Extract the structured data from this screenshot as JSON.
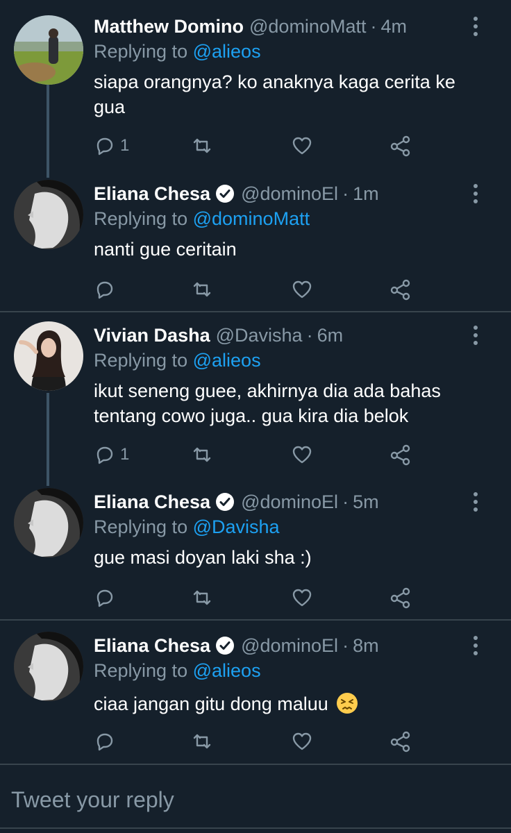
{
  "tweets": [
    {
      "name": "Matthew Domino",
      "handle": "@dominoMatt",
      "separator": "·",
      "time": "4m",
      "replying_prefix": "Replying to",
      "replying_to": "@alieos",
      "text": "siapa orangnya? ko anaknya kaga cerita ke gua",
      "reply_count": "1",
      "verified": false,
      "avatar": "landscape-photo-avatar"
    },
    {
      "name": "Eliana Chesa",
      "handle": "@dominoEl",
      "separator": "·",
      "time": "1m",
      "replying_prefix": "Replying to",
      "replying_to": "@dominoMatt",
      "text": "nanti gue ceritain",
      "reply_count": "",
      "verified": true,
      "avatar": "bw-profile-avatar"
    },
    {
      "name": "Vivian Dasha",
      "handle": "@Davisha",
      "separator": "·",
      "time": "6m",
      "replying_prefix": "Replying to",
      "replying_to": "@alieos",
      "text": "ikut seneng guee, akhirnya dia ada bahas tentang cowo juga.. gua kira dia belok",
      "reply_count": "1",
      "verified": false,
      "avatar": "girl-portrait-avatar"
    },
    {
      "name": "Eliana Chesa",
      "handle": "@dominoEl",
      "separator": "·",
      "time": "5m",
      "replying_prefix": "Replying to",
      "replying_to": "@Davisha",
      "text": "gue masi doyan laki sha :)",
      "reply_count": "",
      "verified": true,
      "avatar": "bw-profile-avatar"
    },
    {
      "name": "Eliana Chesa",
      "handle": "@dominoEl",
      "separator": "·",
      "time": "8m",
      "replying_prefix": "Replying to",
      "replying_to": "@alieos",
      "text": "ciaa jangan gitu dong maluu",
      "reply_count": "",
      "verified": true,
      "avatar": "bw-profile-avatar",
      "emoji": "persevering-face-emoji"
    }
  ],
  "reply_box": {
    "placeholder": "Tweet your reply"
  },
  "icons": {
    "reply": "reply-icon",
    "retweet": "retweet-icon",
    "like": "like-icon",
    "share": "share-icon",
    "more": "more-vertical-icon",
    "verified": "verified-badge-icon"
  },
  "colors": {
    "background": "#15202b",
    "text_primary": "#ffffff",
    "text_secondary": "#8899a6",
    "accent": "#1da1f2",
    "divider": "#38444d",
    "thread_line": "#3d5466"
  }
}
